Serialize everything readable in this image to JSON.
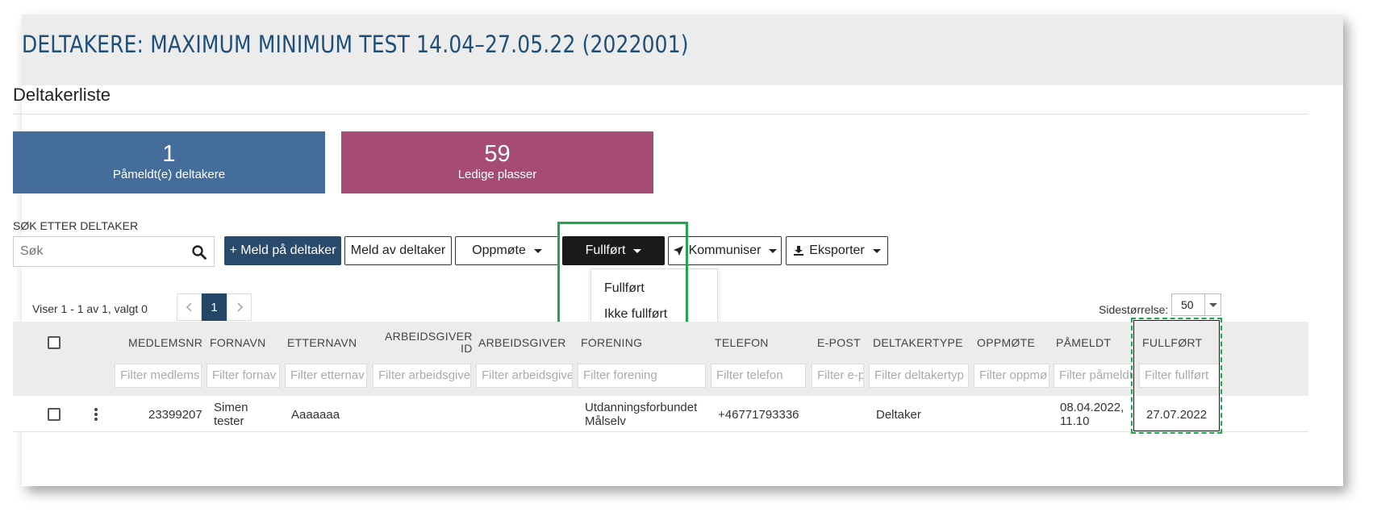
{
  "page": {
    "title": "DELTAKERE: MAXIMUM MINIMUM TEST 14.04–27.05.22 (2022001)",
    "section_title": "Deltakerliste"
  },
  "stats": {
    "registered_count": "1",
    "registered_label": "Påmeldt(e) deltakere",
    "available_count": "59",
    "available_label": "Ledige plasser"
  },
  "search": {
    "label": "SØK ETTER DELTAKER",
    "placeholder": "Søk"
  },
  "toolbar": {
    "add_label": "+ Meld på deltaker",
    "remove_label": "Meld av deltaker",
    "attendance_label": "Oppmøte",
    "completed_label": "Fullført",
    "communicate_label": "Kommuniser",
    "export_label": "Eksporter"
  },
  "completed_menu": {
    "items": [
      "Fullført",
      "Ikke fullført"
    ]
  },
  "pagination": {
    "showing": "Viser 1 - 1 av 1, valgt 0",
    "current_page": "1",
    "page_size_label": "Sidestørrelse:",
    "page_size": "50"
  },
  "table": {
    "columns": [
      "MEDLEMSNR",
      "FORNAVN",
      "ETTERNAVN",
      "ARBEIDSGIVER ID",
      "ARBEIDSGIVER",
      "FORENING",
      "TELEFON",
      "E-POST",
      "DELTAKERTYPE",
      "OPPMØTE",
      "PÅMELDT",
      "FULLFØRT"
    ],
    "col_arbeidsgiver_id_line1": "ARBEIDSGIVER",
    "col_arbeidsgiver_id_line2": "ID",
    "filters": [
      "Filter medlems",
      "Filter fornav",
      "Filter etternav",
      "Filter arbeidsgive",
      "Filter arbeidsgive",
      "Filter forening",
      "Filter telefon",
      "Filter e-p",
      "Filter deltakertyp",
      "Filter oppmø",
      "Filter påmeldt",
      "Filter fullført"
    ],
    "rows": [
      {
        "medlemsnr": "23399207",
        "fornavn_line1": "Simen",
        "fornavn_line2": "tester",
        "etternavn": "Aaaaaaa",
        "forening_line1": "Utdanningsforbundet",
        "forening_line2": "Målselv",
        "telefon": "+46771793336",
        "deltakertype": "Deltaker",
        "pameldt_line1": "08.04.2022,",
        "pameldt_line2": "11.10",
        "fullfort": "27.07.2022"
      }
    ]
  },
  "colors": {
    "title_blue": "#1f4e79",
    "stat_blue": "#456d9b",
    "stat_pink": "#a64b73",
    "primary_button": "#2a4a6b",
    "highlight_green": "#1fa84a"
  }
}
